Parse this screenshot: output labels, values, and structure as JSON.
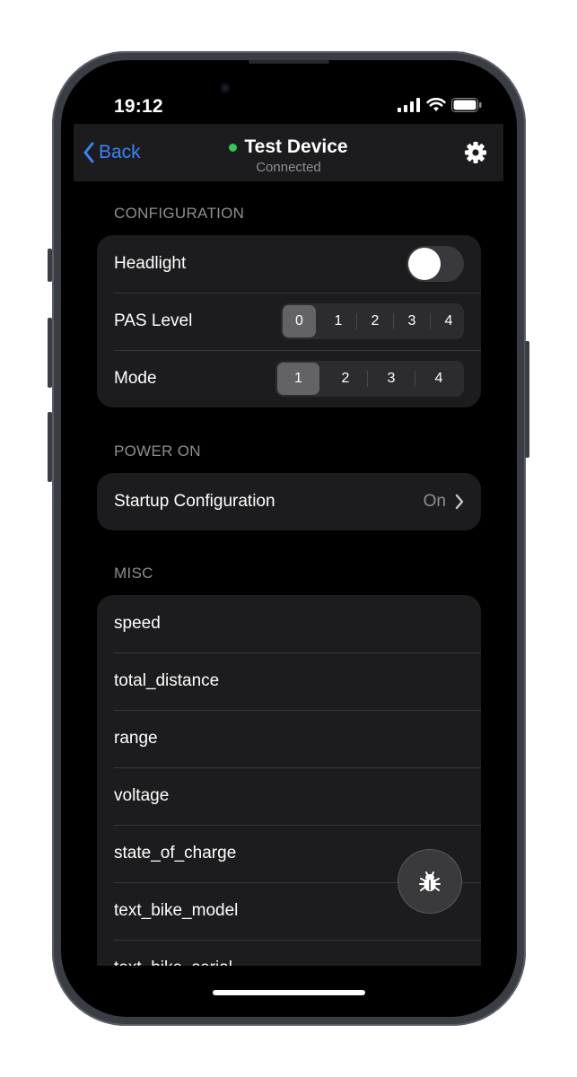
{
  "status_bar": {
    "time": "19:12"
  },
  "nav": {
    "back_label": "Back",
    "title": "Test Device",
    "subtitle": "Connected",
    "status_color": "#34c759"
  },
  "sections": {
    "configuration": {
      "header": "CONFIGURATION",
      "headlight_label": "Headlight",
      "headlight_on": false,
      "pas_label": "PAS Level",
      "pas_options": [
        "0",
        "1",
        "2",
        "3",
        "4"
      ],
      "pas_selected": "0",
      "mode_label": "Mode",
      "mode_options": [
        "1",
        "2",
        "3",
        "4"
      ],
      "mode_selected": "1"
    },
    "power_on": {
      "header": "POWER ON",
      "startup_label": "Startup Configuration",
      "startup_value": "On"
    },
    "misc": {
      "header": "MISC",
      "items": [
        "speed",
        "total_distance",
        "range",
        "voltage",
        "state_of_charge",
        "text_bike_model",
        "text_bike_serial"
      ]
    }
  },
  "colors": {
    "accent": "#3b82f6",
    "background": "#000000",
    "card": "#1c1c1e",
    "secondary_text": "#8e8e93"
  },
  "icons": {
    "back": "chevron-left-icon",
    "settings": "gear-icon",
    "debug": "bug-icon"
  }
}
